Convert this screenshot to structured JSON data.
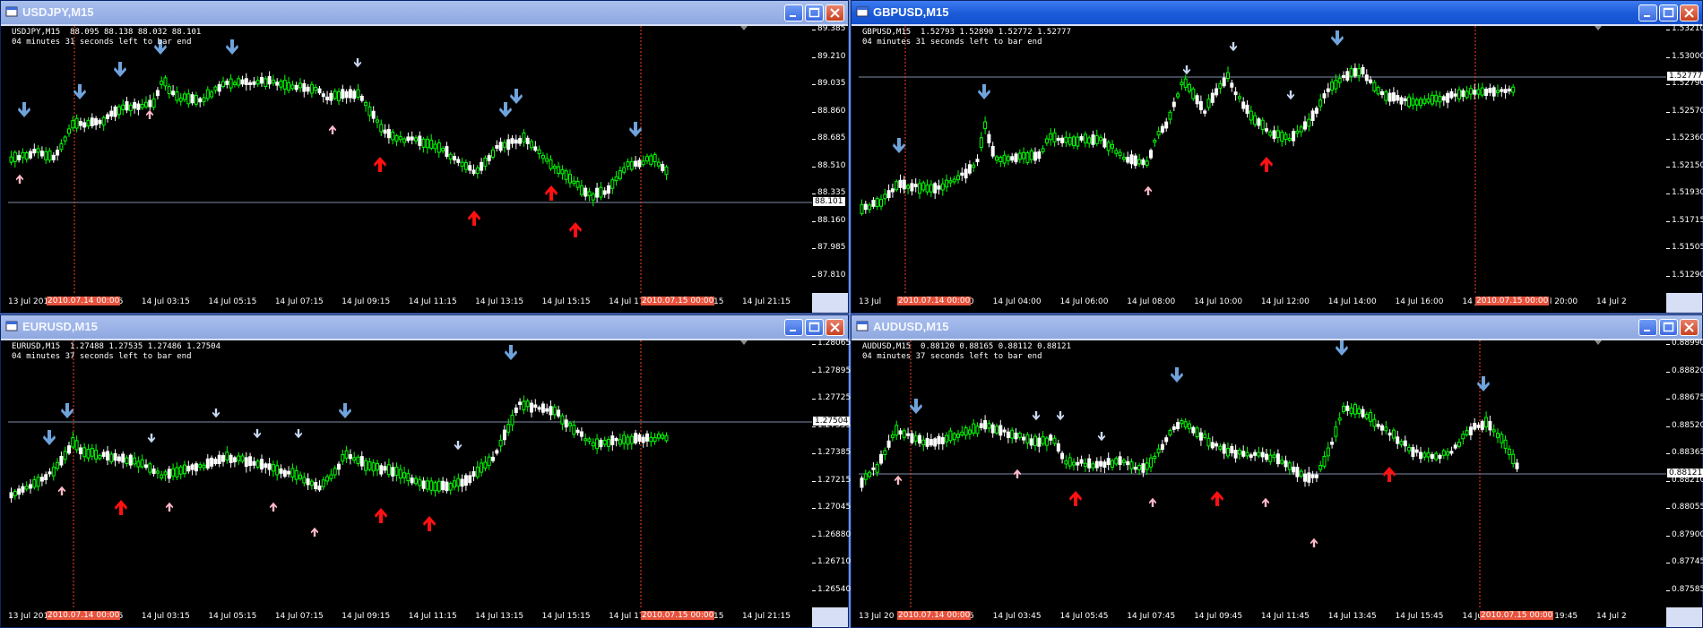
{
  "colors": {
    "bull": "#00ff00",
    "bear": "#ffffff",
    "arrow_down_big": "#6fa3dc",
    "arrow_down_small": "#c7d8f0",
    "arrow_up_big": "#ff1111",
    "arrow_up_small": "#ffb8c8",
    "vline": "#ff4020",
    "hline": "#7f8ca8"
  },
  "windows": [
    {
      "title": "USDJPY,M15",
      "active": false,
      "info_line1": "USDJPY,M15  88.095 88.138 88.032 88.101",
      "info_line2": "04 minutes 31 seconds left to bar end",
      "price_tag": "88.101",
      "y_ticks": [
        "89.385",
        "89.210",
        "89.035",
        "88.860",
        "88.685",
        "88.510",
        "88.335",
        "88.160",
        "87.985",
        "87.810"
      ],
      "x_ticks": [
        "13 Jul 2010",
        "14 Jul 01:15",
        "14 Jul 03:15",
        "14 Jul 05:15",
        "14 Jul 07:15",
        "14 Jul 09:15",
        "14 Jul 11:15",
        "14 Jul 13:15",
        "14 Jul 15:15",
        "14 Jul 17:15",
        "14 Jul 19:15",
        "14 Jul 21:15"
      ],
      "x_sep": [
        "2010.07.14 00:00",
        "2010.07.15 00:00"
      ]
    },
    {
      "title": "GBPUSD,M15",
      "active": true,
      "info_line1": "GBPUSD,M15  1.52793 1.52890 1.52772 1.52777",
      "info_line2": "04 minutes 31 seconds left to bar end",
      "price_tag": "1.52777",
      "y_ticks": [
        "1.53210",
        "1.53000",
        "1.52790",
        "1.52570",
        "1.52360",
        "1.52150",
        "1.51930",
        "1.51715",
        "1.51505",
        "1.51290"
      ],
      "x_ticks": [
        "13 Jul",
        "14 Jul 02:00",
        "14 Jul 04:00",
        "14 Jul 06:00",
        "14 Jul 08:00",
        "14 Jul 10:00",
        "14 Jul 12:00",
        "14 Jul 14:00",
        "14 Jul 16:00",
        "14 Jul 18:00",
        "14 Jul 20:00",
        "14 Jul 2"
      ],
      "x_sep": [
        "2010.07.14 00:00",
        "2010.07.15 00:00"
      ]
    },
    {
      "title": "EURUSD,M15",
      "active": false,
      "info_line1": "EURUSD,M15  1.27488 1.27535 1.27486 1.27504",
      "info_line2": "04 minutes 37 seconds left to bar end",
      "price_tag": "1.27504",
      "y_ticks": [
        "1.28065",
        "1.27895",
        "1.27725",
        "1.27555",
        "1.27385",
        "1.27215",
        "1.27045",
        "1.26880",
        "1.26710",
        "1.26540"
      ],
      "x_ticks": [
        "13 Jul 2010",
        "14 Jul 01:15",
        "14 Jul 03:15",
        "14 Jul 05:15",
        "14 Jul 07:15",
        "14 Jul 09:15",
        "14 Jul 11:15",
        "14 Jul 13:15",
        "14 Jul 15:15",
        "14 Jul 17:15",
        "14 Jul 19:15",
        "14 Jul 21:15"
      ],
      "x_sep": [
        "2010.07.14 00:00",
        "2010.07.15 00:00"
      ]
    },
    {
      "title": "AUDUSD,M15",
      "active": false,
      "info_line1": "AUDUSD,M15  0.88120 0.88165 0.88112 0.88121",
      "info_line2": "04 minutes 37 seconds left to bar end",
      "price_tag": "0.88121",
      "y_ticks": [
        "0.88990",
        "0.88820",
        "0.88675",
        "0.88520",
        "0.88365",
        "0.88210",
        "0.88055",
        "0.87900",
        "0.87745",
        "0.87585"
      ],
      "x_ticks": [
        "13 Jul 20",
        "14 Jul 01:45",
        "14 Jul 03:45",
        "14 Jul 05:45",
        "14 Jul 07:45",
        "14 Jul 09:45",
        "14 Jul 11:45",
        "14 Jul 13:45",
        "14 Jul 15:45",
        "14 Jul 17:45",
        "14 Jul 19:45",
        "14 Jul 2"
      ],
      "x_sep": [
        "2010.07.14 00:00",
        "2010.07.15 00:00"
      ]
    }
  ]
}
